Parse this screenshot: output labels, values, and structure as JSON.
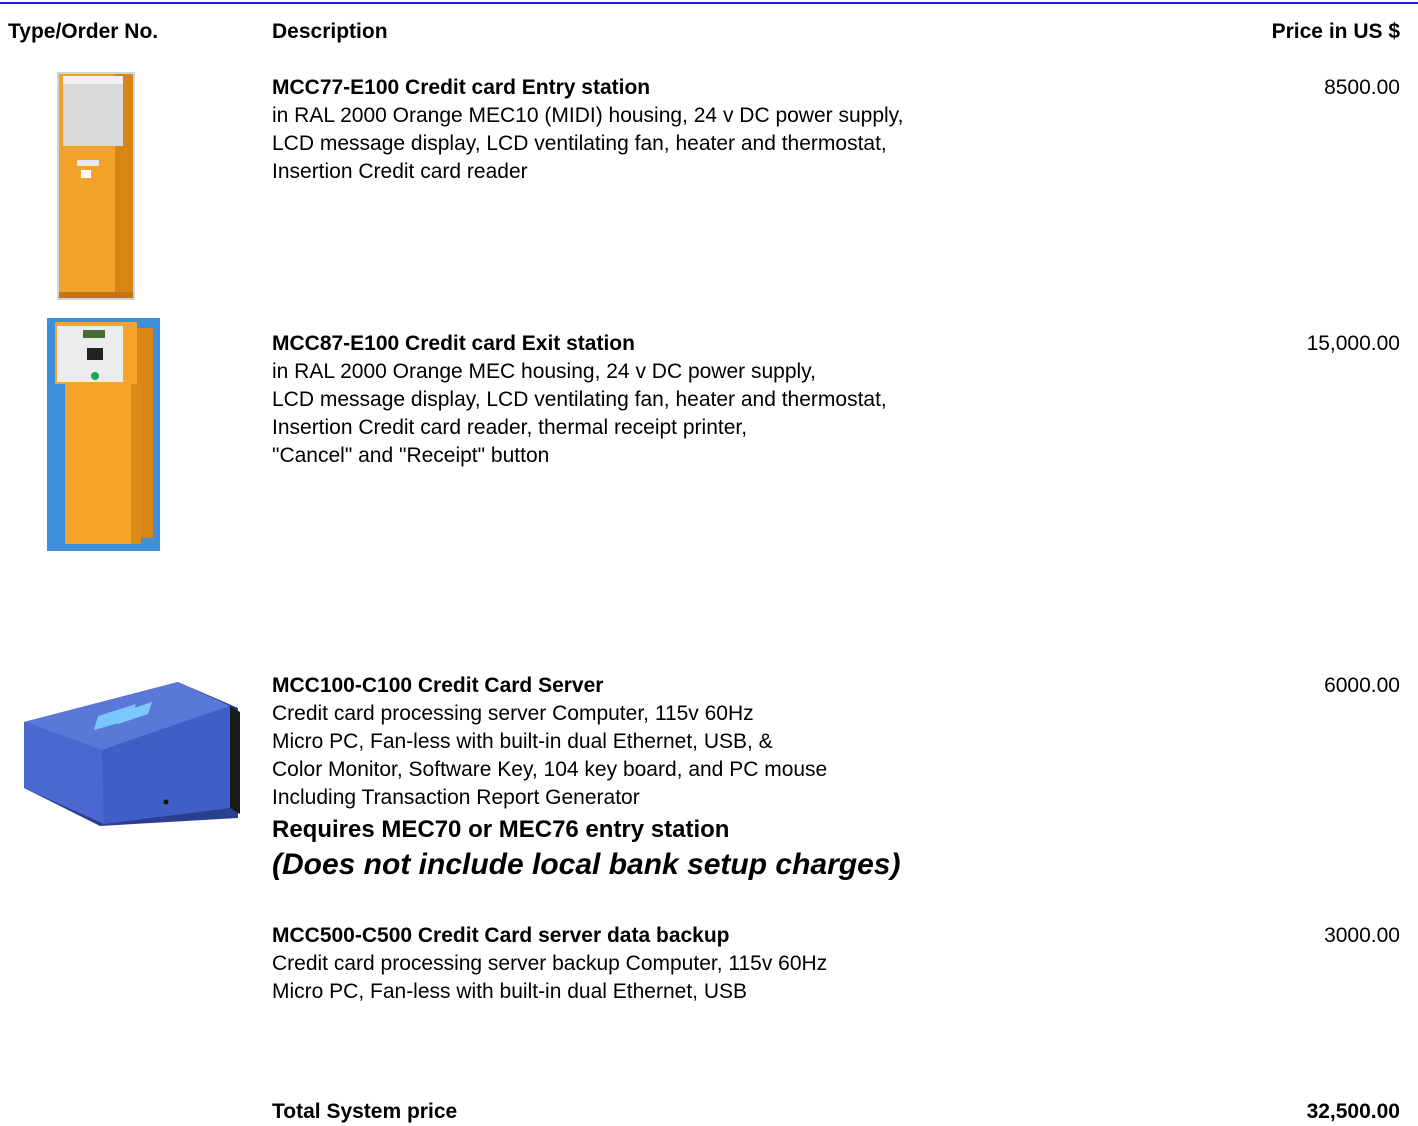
{
  "header": {
    "type_col": "Type/Order No.",
    "desc_col": "Description",
    "price_col": "Price in US $"
  },
  "items": [
    {
      "title": "MCC77-E100 Credit card Entry station",
      "lines": [
        "in RAL 2000 Orange MEC10 (MIDI) housing, 24 v DC power supply,",
        "LCD message display, LCD ventilating fan, heater and thermostat,",
        "Insertion Credit card reader"
      ],
      "price": "8500.00"
    },
    {
      "title": "MCC87-E100 Credit card Exit station",
      "lines": [
        "in RAL 2000 Orange MEC housing, 24 v DC power supply,",
        "LCD message display, LCD ventilating fan, heater and thermostat,",
        "Insertion Credit card reader, thermal receipt printer,",
        "\"Cancel\" and \"Receipt\" button"
      ],
      "price": "15,000.00"
    },
    {
      "title": "MCC100-C100 Credit Card Server",
      "lines": [
        "Credit card processing server Computer, 115v 60Hz",
        "Micro PC, Fan-less with built-in dual Ethernet, USB, &",
        "Color Monitor, Software Key, 104 key board, and PC mouse",
        "Including Transaction Report Generator"
      ],
      "note1": "Requires MEC70 or MEC76 entry station",
      "note2": "(Does not include local bank setup charges)",
      "price": "6000.00"
    },
    {
      "title": "MCC500-C500 Credit Card server data backup",
      "lines": [
        "Credit card processing server backup Computer, 115v 60Hz",
        "Micro PC, Fan-less with built-in dual Ethernet, USB"
      ],
      "price": "3000.00"
    }
  ],
  "total": {
    "label": "Total System price",
    "price": "32,500.00"
  },
  "colors": {
    "rule": "#1f1fd6",
    "station_orange": "#f2a12a",
    "server_blue": "#3f5fc6"
  },
  "images": [
    "entry-station-photo",
    "exit-station-photo",
    "server-photo"
  ]
}
